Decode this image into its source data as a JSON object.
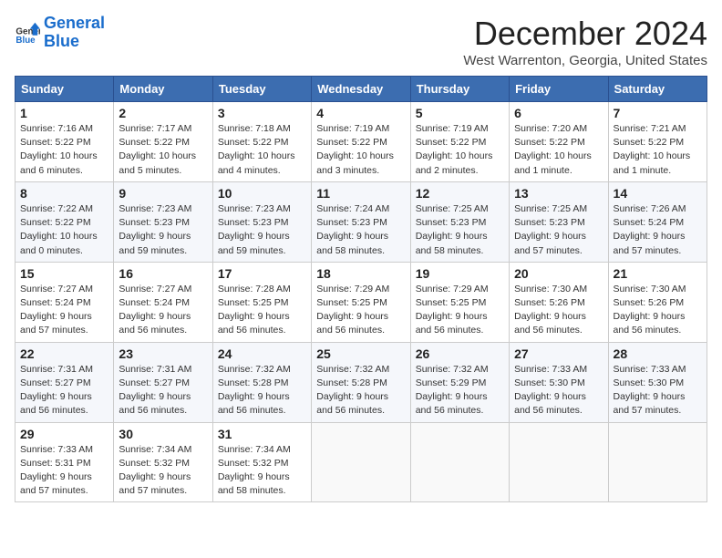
{
  "logo": {
    "line1": "General",
    "line2": "Blue"
  },
  "title": "December 2024",
  "location": "West Warrenton, Georgia, United States",
  "days_of_week": [
    "Sunday",
    "Monday",
    "Tuesday",
    "Wednesday",
    "Thursday",
    "Friday",
    "Saturday"
  ],
  "weeks": [
    [
      {
        "day": "1",
        "sunrise": "7:16 AM",
        "sunset": "5:22 PM",
        "daylight": "10 hours and 6 minutes."
      },
      {
        "day": "2",
        "sunrise": "7:17 AM",
        "sunset": "5:22 PM",
        "daylight": "10 hours and 5 minutes."
      },
      {
        "day": "3",
        "sunrise": "7:18 AM",
        "sunset": "5:22 PM",
        "daylight": "10 hours and 4 minutes."
      },
      {
        "day": "4",
        "sunrise": "7:19 AM",
        "sunset": "5:22 PM",
        "daylight": "10 hours and 3 minutes."
      },
      {
        "day": "5",
        "sunrise": "7:19 AM",
        "sunset": "5:22 PM",
        "daylight": "10 hours and 2 minutes."
      },
      {
        "day": "6",
        "sunrise": "7:20 AM",
        "sunset": "5:22 PM",
        "daylight": "10 hours and 1 minute."
      },
      {
        "day": "7",
        "sunrise": "7:21 AM",
        "sunset": "5:22 PM",
        "daylight": "10 hours and 1 minute."
      }
    ],
    [
      {
        "day": "8",
        "sunrise": "7:22 AM",
        "sunset": "5:22 PM",
        "daylight": "10 hours and 0 minutes."
      },
      {
        "day": "9",
        "sunrise": "7:23 AM",
        "sunset": "5:23 PM",
        "daylight": "9 hours and 59 minutes."
      },
      {
        "day": "10",
        "sunrise": "7:23 AM",
        "sunset": "5:23 PM",
        "daylight": "9 hours and 59 minutes."
      },
      {
        "day": "11",
        "sunrise": "7:24 AM",
        "sunset": "5:23 PM",
        "daylight": "9 hours and 58 minutes."
      },
      {
        "day": "12",
        "sunrise": "7:25 AM",
        "sunset": "5:23 PM",
        "daylight": "9 hours and 58 minutes."
      },
      {
        "day": "13",
        "sunrise": "7:25 AM",
        "sunset": "5:23 PM",
        "daylight": "9 hours and 57 minutes."
      },
      {
        "day": "14",
        "sunrise": "7:26 AM",
        "sunset": "5:24 PM",
        "daylight": "9 hours and 57 minutes."
      }
    ],
    [
      {
        "day": "15",
        "sunrise": "7:27 AM",
        "sunset": "5:24 PM",
        "daylight": "9 hours and 57 minutes."
      },
      {
        "day": "16",
        "sunrise": "7:27 AM",
        "sunset": "5:24 PM",
        "daylight": "9 hours and 56 minutes."
      },
      {
        "day": "17",
        "sunrise": "7:28 AM",
        "sunset": "5:25 PM",
        "daylight": "9 hours and 56 minutes."
      },
      {
        "day": "18",
        "sunrise": "7:29 AM",
        "sunset": "5:25 PM",
        "daylight": "9 hours and 56 minutes."
      },
      {
        "day": "19",
        "sunrise": "7:29 AM",
        "sunset": "5:25 PM",
        "daylight": "9 hours and 56 minutes."
      },
      {
        "day": "20",
        "sunrise": "7:30 AM",
        "sunset": "5:26 PM",
        "daylight": "9 hours and 56 minutes."
      },
      {
        "day": "21",
        "sunrise": "7:30 AM",
        "sunset": "5:26 PM",
        "daylight": "9 hours and 56 minutes."
      }
    ],
    [
      {
        "day": "22",
        "sunrise": "7:31 AM",
        "sunset": "5:27 PM",
        "daylight": "9 hours and 56 minutes."
      },
      {
        "day": "23",
        "sunrise": "7:31 AM",
        "sunset": "5:27 PM",
        "daylight": "9 hours and 56 minutes."
      },
      {
        "day": "24",
        "sunrise": "7:32 AM",
        "sunset": "5:28 PM",
        "daylight": "9 hours and 56 minutes."
      },
      {
        "day": "25",
        "sunrise": "7:32 AM",
        "sunset": "5:28 PM",
        "daylight": "9 hours and 56 minutes."
      },
      {
        "day": "26",
        "sunrise": "7:32 AM",
        "sunset": "5:29 PM",
        "daylight": "9 hours and 56 minutes."
      },
      {
        "day": "27",
        "sunrise": "7:33 AM",
        "sunset": "5:30 PM",
        "daylight": "9 hours and 56 minutes."
      },
      {
        "day": "28",
        "sunrise": "7:33 AM",
        "sunset": "5:30 PM",
        "daylight": "9 hours and 57 minutes."
      }
    ],
    [
      {
        "day": "29",
        "sunrise": "7:33 AM",
        "sunset": "5:31 PM",
        "daylight": "9 hours and 57 minutes."
      },
      {
        "day": "30",
        "sunrise": "7:34 AM",
        "sunset": "5:32 PM",
        "daylight": "9 hours and 57 minutes."
      },
      {
        "day": "31",
        "sunrise": "7:34 AM",
        "sunset": "5:32 PM",
        "daylight": "9 hours and 58 minutes."
      },
      null,
      null,
      null,
      null
    ]
  ]
}
